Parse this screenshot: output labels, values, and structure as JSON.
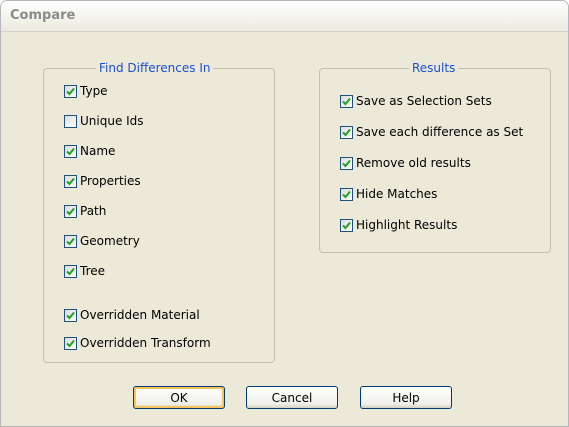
{
  "window": {
    "title": "Compare"
  },
  "find_differences": {
    "legend": "Find Differences In",
    "items": [
      {
        "label": "Type",
        "checked": true
      },
      {
        "label": "Unique Ids",
        "checked": false
      },
      {
        "label": "Name",
        "checked": true
      },
      {
        "label": "Properties",
        "checked": true
      },
      {
        "label": "Path",
        "checked": true
      },
      {
        "label": "Geometry",
        "checked": true
      },
      {
        "label": "Tree",
        "checked": true
      },
      {
        "label": "Overridden Material",
        "checked": true
      },
      {
        "label": "Overridden Transform",
        "checked": true
      }
    ]
  },
  "results": {
    "legend": "Results",
    "items": [
      {
        "label": "Save as Selection Sets",
        "checked": true
      },
      {
        "label": "Save each difference as Set",
        "checked": true
      },
      {
        "label": "Remove old results",
        "checked": true
      },
      {
        "label": "Hide Matches",
        "checked": true
      },
      {
        "label": "Highlight Results",
        "checked": true
      }
    ]
  },
  "buttons": {
    "ok": "OK",
    "cancel": "Cancel",
    "help": "Help"
  },
  "colors": {
    "legend": "#1b4fd1",
    "check": "#21a121",
    "checkbox_border": "#1c5180",
    "dialog_bg": "#ece9d8"
  }
}
